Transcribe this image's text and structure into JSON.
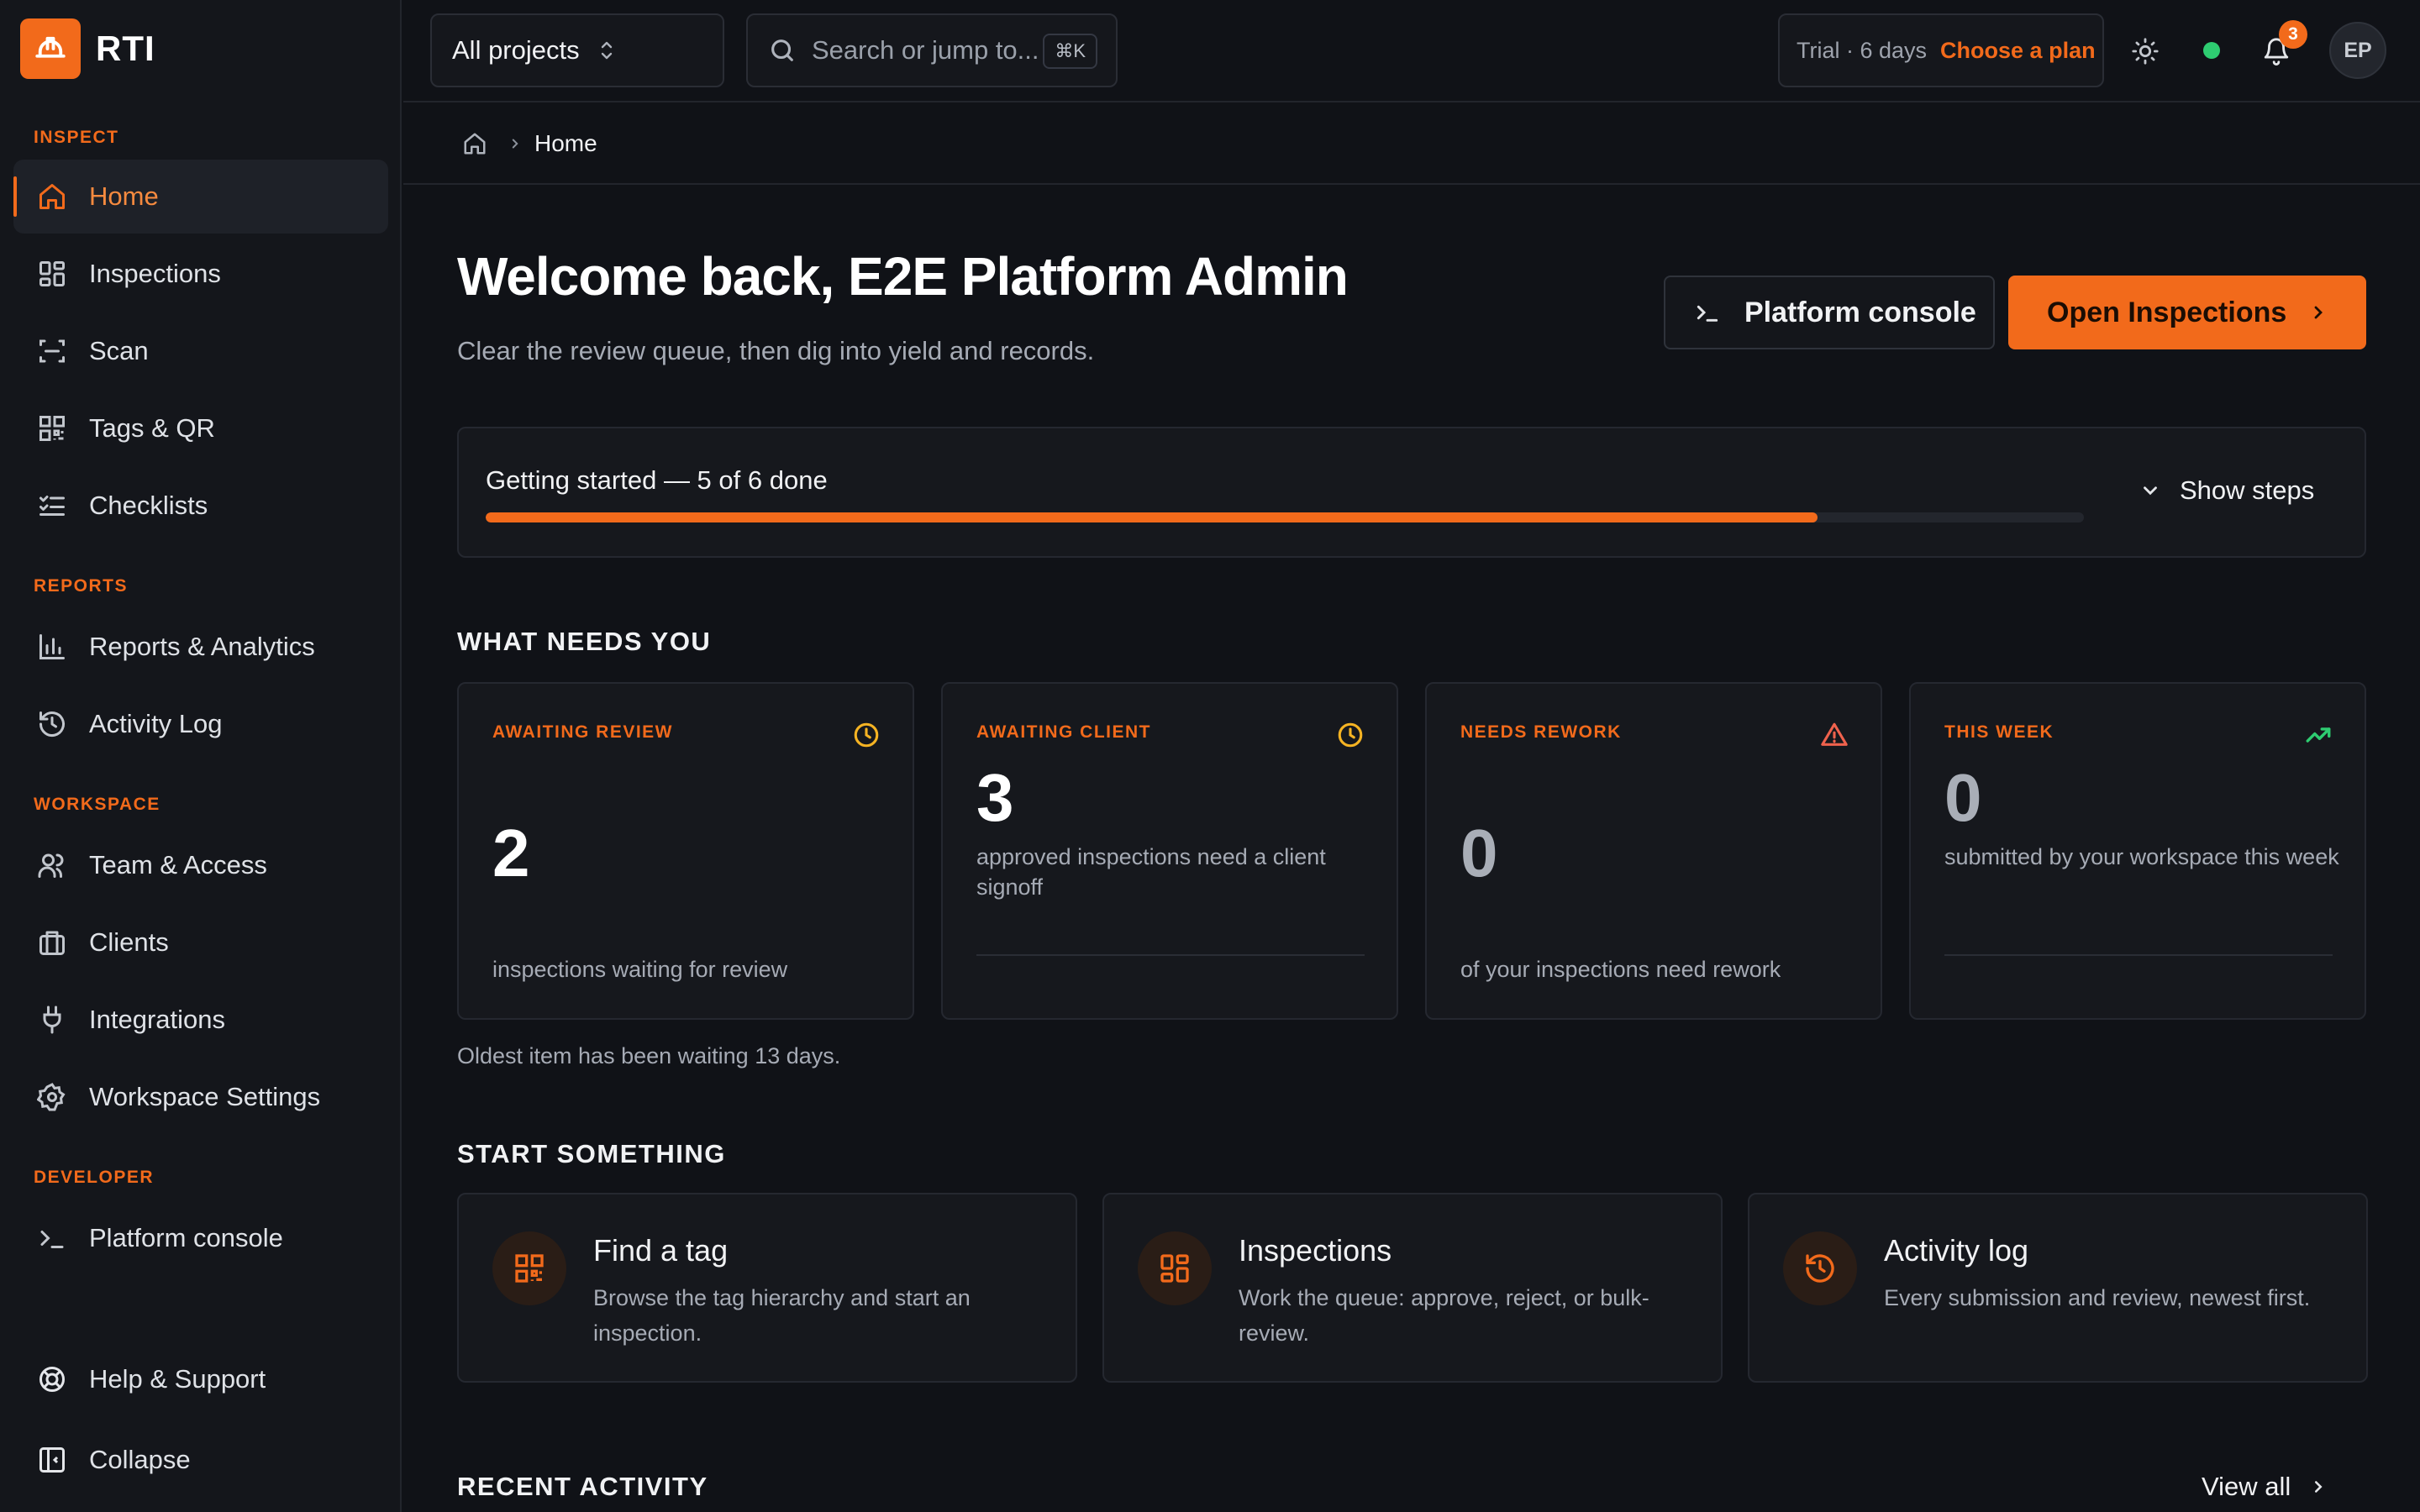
{
  "brand": {
    "name": "RTI",
    "logo_icon": "hardhat-icon",
    "accent": "#f26a1b"
  },
  "sidebar": {
    "sections": [
      {
        "title": "INSPECT",
        "items": [
          {
            "label": "Home",
            "icon": "home-icon",
            "active": true
          },
          {
            "label": "Inspections",
            "icon": "grid-icon"
          },
          {
            "label": "Scan",
            "icon": "scan-icon"
          },
          {
            "label": "Tags & QR",
            "icon": "qr-icon"
          },
          {
            "label": "Checklists",
            "icon": "checklist-icon"
          }
        ]
      },
      {
        "title": "REPORTS",
        "items": [
          {
            "label": "Reports & Analytics",
            "icon": "bar-chart-icon"
          },
          {
            "label": "Activity Log",
            "icon": "history-icon"
          }
        ]
      },
      {
        "title": "WORKSPACE",
        "items": [
          {
            "label": "Team & Access",
            "icon": "users-icon"
          },
          {
            "label": "Clients",
            "icon": "briefcase-icon"
          },
          {
            "label": "Integrations",
            "icon": "plug-icon"
          },
          {
            "label": "Workspace Settings",
            "icon": "gear-icon"
          }
        ]
      },
      {
        "title": "DEVELOPER",
        "items": [
          {
            "label": "Platform console",
            "icon": "terminal-icon"
          }
        ]
      }
    ],
    "footer": {
      "help_label": "Help & Support",
      "collapse_label": "Collapse"
    }
  },
  "topbar": {
    "project_select": "All projects",
    "search_placeholder": "Search or jump to...",
    "search_shortcut": "⌘K",
    "trial_text": "Trial · 6 days",
    "trial_cta": "Choose a plan",
    "notification_count": "3",
    "avatar_initials": "EP",
    "status_color": "#2ecc71"
  },
  "breadcrumb": {
    "current": "Home"
  },
  "main": {
    "title": "Welcome back, E2E Platform Admin",
    "subtitle": "Clear the review queue, then dig into yield and records.",
    "console_button": "Platform console",
    "open_button": "Open Inspections",
    "progress": {
      "label": "Getting started — 5 of 6 done",
      "done": 5,
      "total": 6,
      "toggle": "Show steps"
    },
    "needs_title": "WHAT NEEDS YOU",
    "stats": [
      {
        "tag": "AWAITING REVIEW",
        "value": "2",
        "desc": "inspections waiting for review",
        "icon": "clock-icon",
        "icon_color": "#f5b323"
      },
      {
        "tag": "AWAITING CLIENT",
        "value": "3",
        "desc": "approved inspections need a client signoff",
        "icon": "clock-icon",
        "icon_color": "#f5b323"
      },
      {
        "tag": "NEEDS REWORK",
        "value": "0",
        "desc": "of your inspections need rework",
        "icon": "warning-icon",
        "icon_color": "#f0624d"
      },
      {
        "tag": "THIS WEEK",
        "value": "0",
        "desc": "submitted by your workspace this week",
        "icon": "trending-up-icon",
        "icon_color": "#2ecc71"
      }
    ],
    "oldest_note": "Oldest item has been waiting 13 days.",
    "start_title": "START SOMETHING",
    "actions": [
      {
        "title": "Find a tag",
        "desc": "Browse the tag hierarchy and start an inspection.",
        "icon": "qr-icon"
      },
      {
        "title": "Inspections",
        "desc": "Work the queue: approve, reject, or bulk-review.",
        "icon": "grid-icon"
      },
      {
        "title": "Activity log",
        "desc": "Every submission and review, newest first.",
        "icon": "history-icon"
      }
    ],
    "recent_title": "RECENT ACTIVITY",
    "view_all": "View all"
  }
}
